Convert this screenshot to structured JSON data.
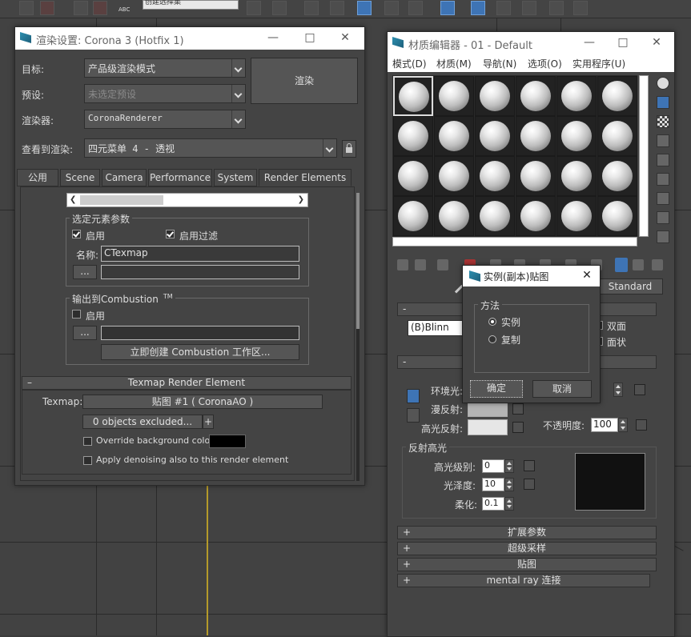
{
  "toolbar": {
    "dropdown_text": "创建选择集",
    "menu_stub": "ABC"
  },
  "render_setup": {
    "title": "渲染设置: Corona 3 (Hotfix 1)",
    "target_label": "目标:",
    "target_value": "产品级渲染模式",
    "preset_label": "预设:",
    "preset_placeholder": "未选定预设",
    "renderer_label": "渲染器:",
    "renderer_value": "CoronaRenderer",
    "view_label": "查看到渲染:",
    "view_value": "四元菜单 4 - 透视",
    "render_button": "渲染",
    "tabs": [
      "公用",
      "Scene",
      "Camera",
      "Performance",
      "System",
      "Render Elements"
    ],
    "active_tab": "Render Elements",
    "element_group_title": "选定元素参数",
    "enable_label": "启用",
    "filter_label": "启用过滤",
    "enable_checked": true,
    "filter_checked": true,
    "name_label": "名称:",
    "name_value": "CTexmap",
    "browse_label": "...",
    "combustion_title": "输出到Combustion",
    "combustion_tm": "TM",
    "combustion_enable": "启用",
    "combustion_enable_checked": false,
    "combustion_create": "立即创建 Combustion 工作区...",
    "texmap_rollout": "Texmap Render Element",
    "texmap_label": "Texmap:",
    "texmap_value": "贴图 #1 ( CoronaAO )",
    "excluded": "0 objects excluded...",
    "plus": "+",
    "override_bg": "Override background color:",
    "apply_denoise": "Apply denoising also to this render element",
    "override_checked": false,
    "denoise_checked": false,
    "minus": "–"
  },
  "material_editor": {
    "title": "材质编辑器 - 01 - Default",
    "menus": [
      "模式(D)",
      "材质(M)",
      "导航(N)",
      "选项(O)",
      "实用程序(U)"
    ],
    "shader": "(B)Blinn",
    "two_sided": "双面",
    "faceted": "面状",
    "standard_btn": "Standard",
    "ambient_label": "环境光:",
    "diffuse_label": "漫反射:",
    "specular_label": "高光反射:",
    "opacity_label": "不透明度:",
    "opacity_value": "100",
    "spec_highlights": "反射高光",
    "spec_level_label": "高光级别:",
    "spec_level_value": "0",
    "gloss_label": "光泽度:",
    "gloss_value": "10",
    "soften_label": "柔化:",
    "soften_value": "0.1",
    "rollouts": [
      "扩展参数",
      "超级采样",
      "贴图",
      "mental ray 连接"
    ],
    "plus": "+",
    "minus": "-"
  },
  "dialog": {
    "title": "实例(副本)贴图",
    "method_title": "方法",
    "instance": "实例",
    "copy": "复制",
    "instance_selected": true,
    "ok": "确定",
    "cancel": "取消"
  },
  "colors": {
    "viewport_bg": "#424242",
    "panel_bg": "#444444",
    "accent_blue": "#3e74b5",
    "viewport_border_yellow": "#b59a2a"
  }
}
